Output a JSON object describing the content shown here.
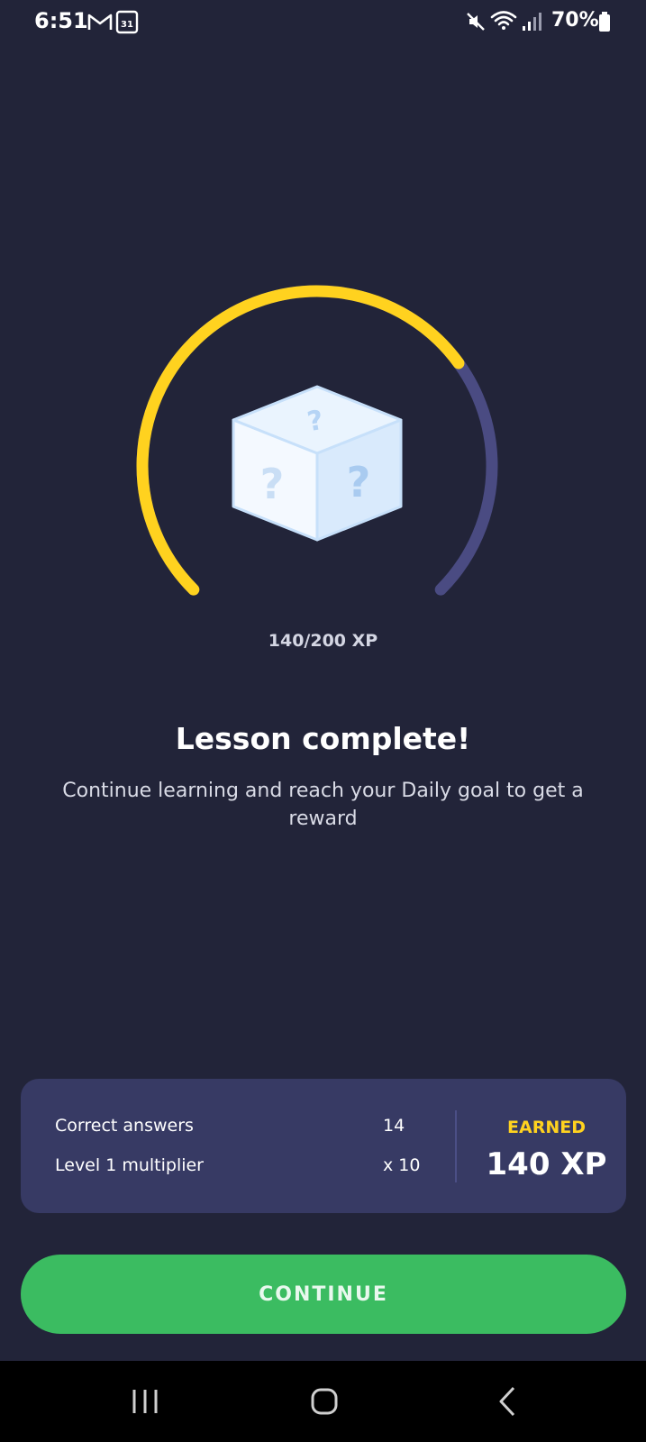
{
  "status_bar": {
    "time": "6:51",
    "battery": "70%",
    "icons": [
      "gmail-icon",
      "calendar-icon",
      "mute-icon",
      "wifi-icon",
      "signal-icon",
      "battery-icon"
    ],
    "calendar_day": "31"
  },
  "progress": {
    "current_xp": 140,
    "goal_xp": 200,
    "label": "140/200 XP",
    "fraction": 0.7,
    "colors": {
      "filled": "#ffd21f",
      "remaining": "#4a4b82"
    }
  },
  "reward_icon": "mystery-box-icon",
  "lesson": {
    "title": "Lesson complete!",
    "subtitle": "Continue learning and reach your Daily goal to get a reward"
  },
  "summary": {
    "rows": [
      {
        "label": "Correct answers",
        "value": "14"
      },
      {
        "label": "Level 1 multiplier",
        "value": "x 10"
      }
    ],
    "earned_label": "EARNED",
    "earned_value": "140 XP"
  },
  "continue_label": "CONTINUE",
  "nav": {
    "icons": [
      "recent-apps-icon",
      "home-icon",
      "back-icon"
    ]
  },
  "colors": {
    "background": "#222439",
    "card": "#373a64",
    "accent_yellow": "#ffd21f",
    "button_green": "#3bbc61"
  }
}
